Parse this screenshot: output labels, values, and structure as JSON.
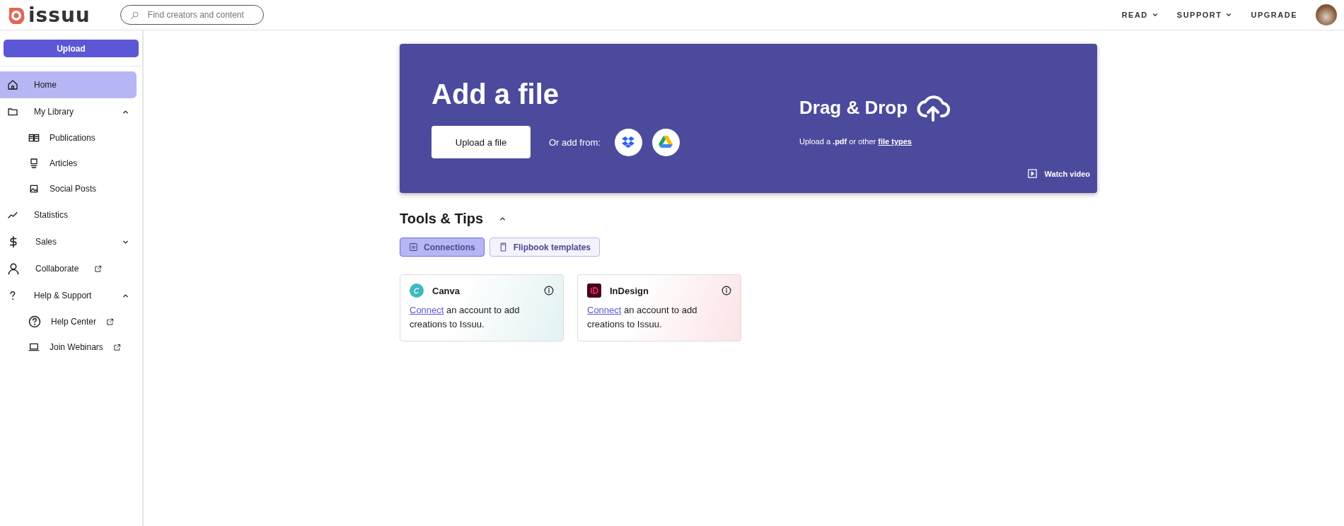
{
  "header": {
    "logo": "issuu",
    "search": {
      "placeholder": "Find creators and content"
    },
    "nav": [
      {
        "label": "READ",
        "dropdown": true
      },
      {
        "label": "SUPPORT",
        "dropdown": true
      },
      {
        "label": "UPGRADE",
        "dropdown": false
      }
    ]
  },
  "sidebar": {
    "upload": "Upload",
    "items": [
      {
        "label": "Home",
        "selected": true,
        "external": false
      },
      {
        "label": "My Library",
        "selected": false,
        "external": false,
        "expanded": true,
        "children": [
          {
            "label": "Publications",
            "selected": false,
            "external": false
          },
          {
            "label": "Articles",
            "selected": false,
            "external": false
          },
          {
            "label": "Social Posts",
            "selected": false,
            "external": false
          }
        ]
      },
      {
        "label": "Statistics",
        "selected": false,
        "external": false
      },
      {
        "label": "Sales",
        "selected": false,
        "external": false,
        "expanded": false
      },
      {
        "label": "Collaborate",
        "selected": false,
        "external": true
      },
      {
        "label": "Help & Support",
        "selected": false,
        "external": false,
        "expanded": true,
        "children": [
          {
            "label": "Help Center",
            "selected": false,
            "external": true
          },
          {
            "label": "Join Webinars",
            "selected": false,
            "external": true
          }
        ]
      }
    ]
  },
  "hero": {
    "title": "Add a file",
    "upload_button": "Upload a file",
    "or_add": "Or add from:",
    "drop_title": "Drag & Drop",
    "drop_hint": "Upload a **.pdf** or other",
    "drop_link": "file types",
    "watch_video": "Watch video"
  },
  "tools": {
    "title": "Tools & Tips",
    "expanded": true,
    "tabs": [
      {
        "label": "Connections",
        "selected": true
      },
      {
        "label": "Flipbook templates",
        "selected": false
      }
    ],
    "cards": [
      {
        "kind": "canva",
        "name": "Canva",
        "link": "Connect",
        "text": "an account to add creations to Issuu.",
        "color": "#e3f2f3"
      },
      {
        "kind": "indesign",
        "name": "InDesign",
        "link": "Connect",
        "text": "an account to add creations to Issuu.",
        "color": "#fbe3e6"
      }
    ]
  }
}
